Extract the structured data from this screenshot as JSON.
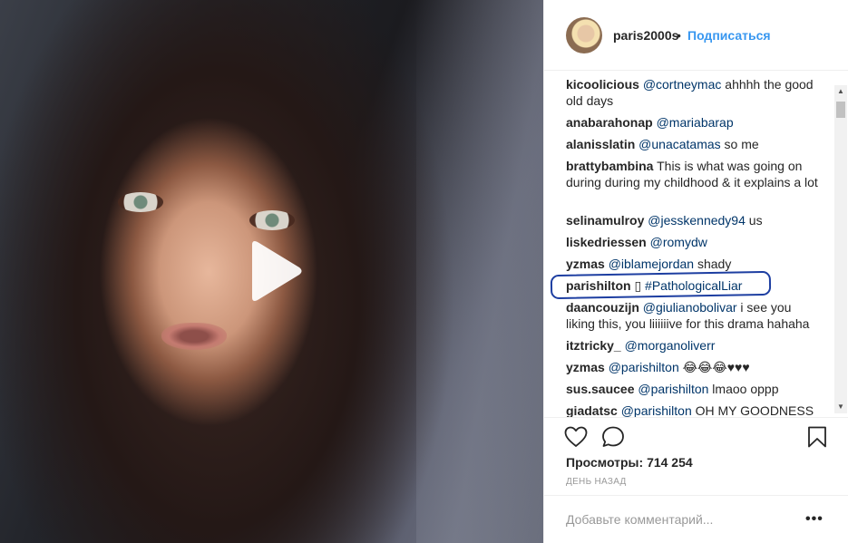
{
  "header": {
    "username": "paris2000s",
    "separator": "•",
    "follow_label": "Подписаться"
  },
  "video": {
    "play_icon": "play-icon"
  },
  "comments": [
    {
      "author": "kicoolicious",
      "mention": "@cortneymac",
      "text": " ahhhh the good old days"
    },
    {
      "author": "anabarahonap",
      "mention": "@mariabarap",
      "text": ""
    },
    {
      "author": "alanisslatin",
      "mention": "@unacatamas",
      "text": " so me"
    },
    {
      "author": "brattybambina",
      "mention": "",
      "text": " This is what was going on during during my childhood & it explains a lot"
    },
    {
      "author": "selinamulroy",
      "mention": "@jesskennedy94",
      "text": " us"
    },
    {
      "author": "liskedriessen",
      "mention": "@romydw",
      "text": ""
    },
    {
      "author": "yzmas",
      "mention": "@iblamejordan",
      "text": " shady"
    },
    {
      "author": "parishilton",
      "mention": "#PathologicalLiar",
      "prefix": " ▯ ",
      "text": ""
    },
    {
      "author": "daancouzijn",
      "mention": "@giulianobolivar",
      "text": " i see you liking this, you liiiiiive for this drama hahaha"
    },
    {
      "author": "itztricky_",
      "mention": "@morganoliverr",
      "text": ""
    },
    {
      "author": "yzmas",
      "mention": "@parishilton",
      "text": " 😂😂😂♥♥♥"
    },
    {
      "author": "sus.saucee",
      "mention": "@parishilton",
      "text": " lmaoo oppp"
    },
    {
      "author": "giadatsc",
      "mention": "@parishilton",
      "text": " OH MY GOODNESS"
    }
  ],
  "stats": {
    "views_label": "Просмотры:",
    "views_value": "714 254",
    "time_ago": "ДЕНЬ НАЗАД"
  },
  "add_comment": {
    "placeholder": "Добавьте комментарий...",
    "more_label": "•••"
  },
  "icons": {
    "like": "heart-icon",
    "comment": "comment-bubble-icon",
    "save": "bookmark-icon",
    "more": "more-options-icon"
  },
  "colors": {
    "link": "#3897f0",
    "mention": "#003569",
    "highlight": "#1d3ea1",
    "muted": "#999999"
  }
}
